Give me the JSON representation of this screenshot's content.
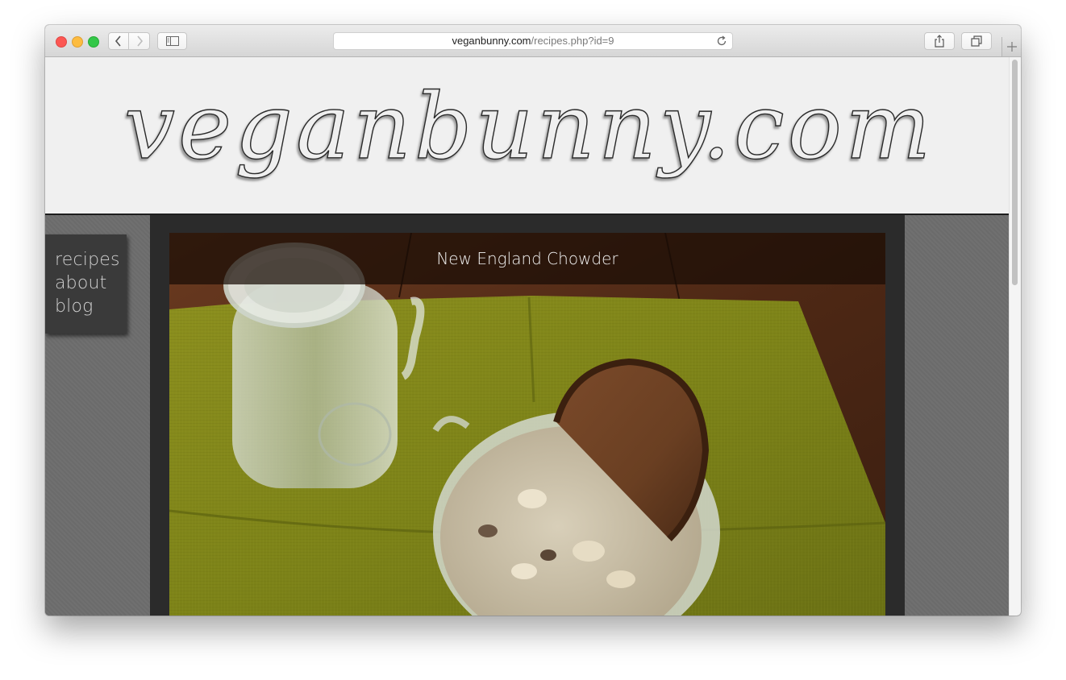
{
  "browser": {
    "url_domain": "veganbunny.com",
    "url_path": "/recipes.php?id=9",
    "icons": {
      "back": "chevron-left-icon",
      "forward": "chevron-right-icon",
      "sidebar": "sidebar-icon",
      "reload": "reload-icon",
      "share": "share-icon",
      "tabs": "tabs-overview-icon",
      "new_tab": "plus-icon"
    }
  },
  "site": {
    "logo_text": "veganbunny.com",
    "nav": [
      {
        "label": "recipes"
      },
      {
        "label": "about"
      },
      {
        "label": "blog"
      }
    ]
  },
  "recipe": {
    "title": "New England Chowder",
    "image": "photo of chowder in a glass bowl with rye bread and a mason jar of water on a green napkin"
  },
  "colors": {
    "header_bg": "#f0f0f0",
    "page_bg": "#707070",
    "nav_bg": "#3a3a3a",
    "content_bg": "#2b2b2b"
  }
}
